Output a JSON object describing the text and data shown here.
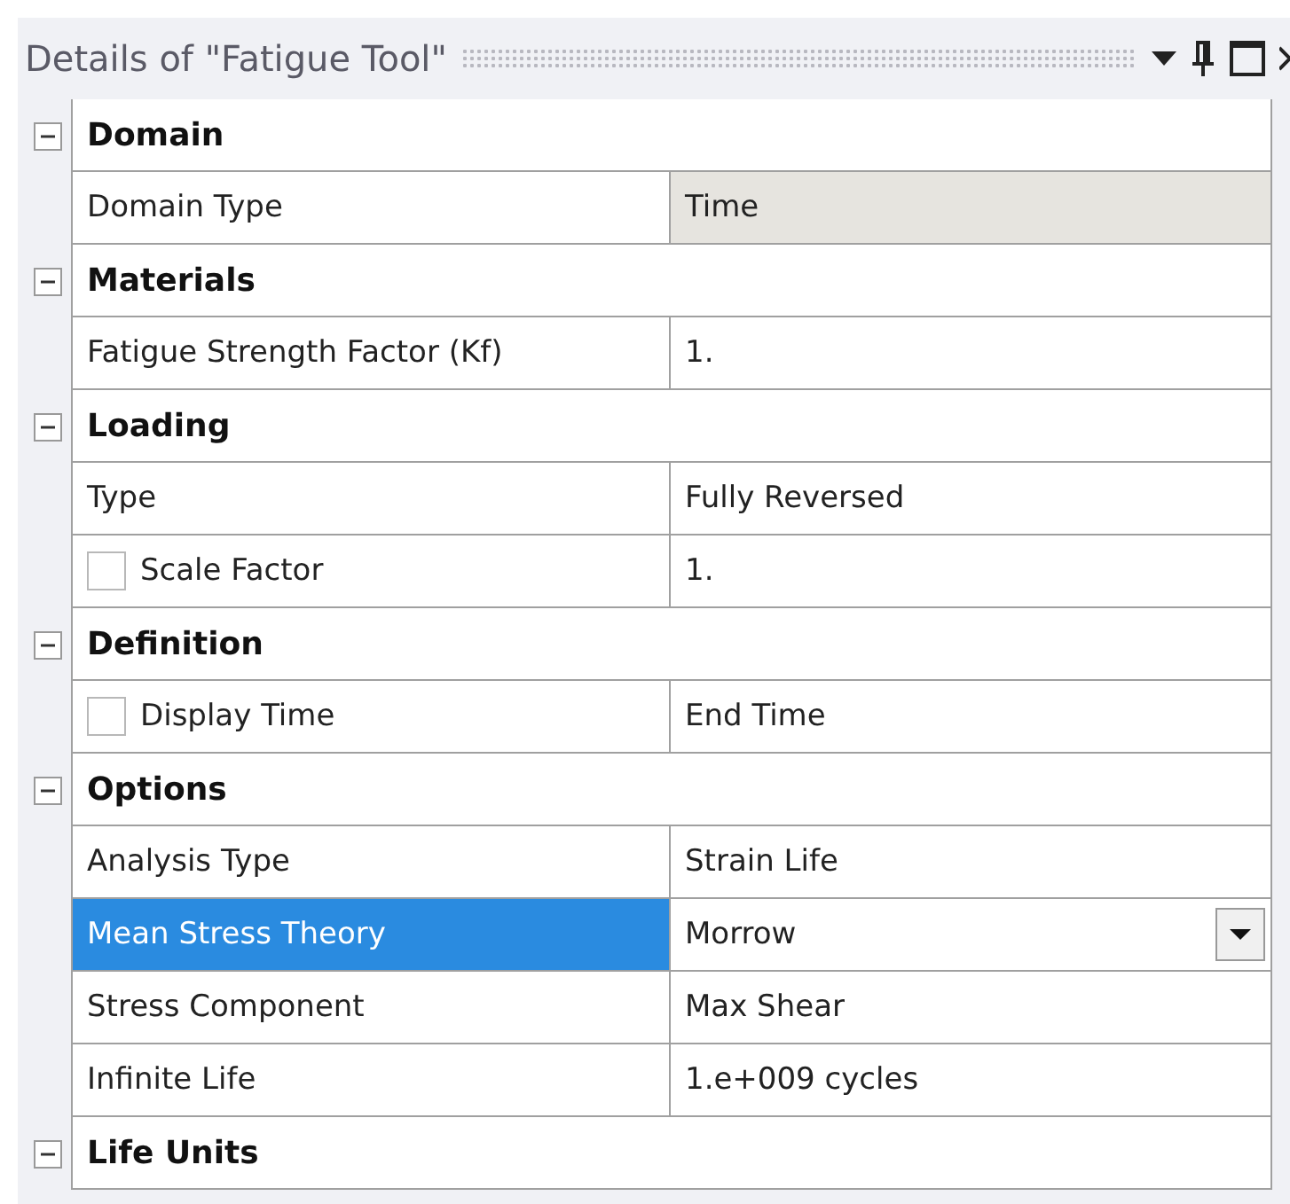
{
  "panel": {
    "title": "Details of \"Fatigue Tool\""
  },
  "sections": [
    {
      "title": "Domain",
      "expanded": true,
      "rows": [
        {
          "label": "Domain Type",
          "value": "Time",
          "kind": "plain",
          "readonly": true,
          "selected": false
        }
      ]
    },
    {
      "title": "Materials",
      "expanded": true,
      "rows": [
        {
          "label": "Fatigue Strength Factor (Kf)",
          "value": "1.",
          "kind": "plain",
          "readonly": false,
          "selected": false
        }
      ]
    },
    {
      "title": "Loading",
      "expanded": true,
      "rows": [
        {
          "label": "Type",
          "value": "Fully Reversed",
          "kind": "plain",
          "readonly": false,
          "selected": false
        },
        {
          "label": "Scale Factor",
          "value": "1.",
          "kind": "checkbox",
          "checked": false,
          "readonly": false,
          "selected": false
        }
      ]
    },
    {
      "title": "Definition",
      "expanded": true,
      "rows": [
        {
          "label": "Display Time",
          "value": "End Time",
          "kind": "checkbox",
          "checked": false,
          "readonly": false,
          "selected": false
        }
      ]
    },
    {
      "title": "Options",
      "expanded": true,
      "rows": [
        {
          "label": "Analysis Type",
          "value": "Strain Life",
          "kind": "plain",
          "readonly": false,
          "selected": false
        },
        {
          "label": "Mean Stress Theory",
          "value": "Morrow",
          "kind": "dropdown",
          "readonly": false,
          "selected": true
        },
        {
          "label": "Stress Component",
          "value": "Max Shear",
          "kind": "plain",
          "readonly": false,
          "selected": false
        },
        {
          "label": "Infinite Life",
          "value": "1.e+009 cycles",
          "kind": "plain",
          "readonly": false,
          "selected": false
        }
      ]
    },
    {
      "title": "Life Units",
      "expanded": true
    }
  ]
}
